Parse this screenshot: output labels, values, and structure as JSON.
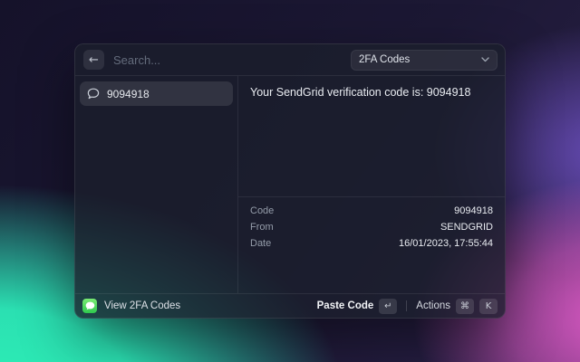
{
  "header": {
    "back_icon_glyph": "←",
    "search_placeholder": "Search...",
    "dropdown": {
      "value": "2FA Codes"
    }
  },
  "list": {
    "items": [
      {
        "icon": "message-bubble",
        "label": "9094918",
        "selected": true
      }
    ]
  },
  "detail": {
    "message": "Your SendGrid verification code is: 9094918",
    "metadata": [
      {
        "label": "Code",
        "value": "9094918"
      },
      {
        "label": "From",
        "value": "SENDGRID"
      },
      {
        "label": "Date",
        "value": "16/01/2023, 17:55:44"
      }
    ]
  },
  "footer": {
    "app_icon": "messages-app",
    "app_label": "View 2FA Codes",
    "primary_action": {
      "label": "Paste Code",
      "key": "↵"
    },
    "secondary_action": {
      "label": "Actions",
      "keys": [
        "⌘",
        "K"
      ]
    }
  },
  "colors": {
    "teal": "#2df0b6",
    "pink": "#e95ece",
    "purple": "#7052c6",
    "dark_base": "#1c1834",
    "window_bg": "rgba(27,31,44,0.78)",
    "app_icon_green": "#2fc94e"
  }
}
